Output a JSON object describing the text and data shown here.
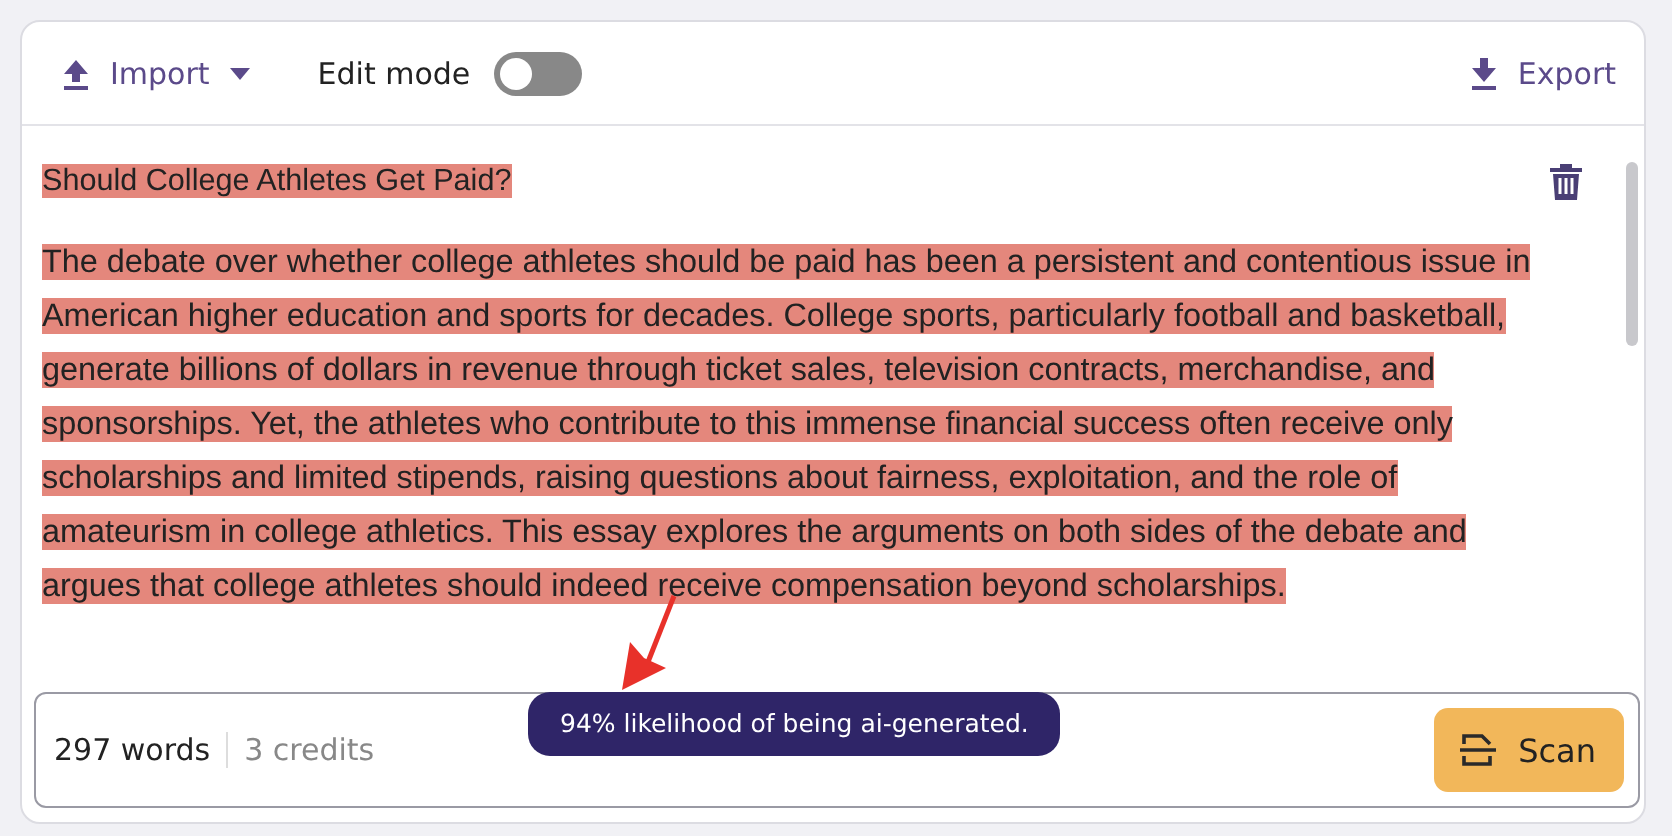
{
  "toolbar": {
    "import_label": "Import",
    "edit_mode": {
      "label": "Edit mode",
      "on": false
    },
    "export_label": "Export"
  },
  "document": {
    "blocks": [
      {
        "kind": "title",
        "text": "Should College Athletes Get Paid?",
        "highlighted": true
      },
      {
        "kind": "paragraph",
        "text": "The debate over whether college athletes should be paid has been a persistent and contentious issue in American higher education and sports for decades.  College sports, particularly football and basketball, generate billions of dollars in revenue through ticket sales, television contracts, merchandise, and sponsorships.  Yet, the athletes who contribute to this immense financial success often receive only scholarships and limited stipends, raising questions about fairness, exploitation, and the role of amateurism in college athletics.  This essay explores the arguments on both sides of the debate and argues that college athletes should indeed receive compensation beyond scholarships.",
        "highlighted": true
      }
    ]
  },
  "footer": {
    "words": "297 words",
    "credits": "3 credits",
    "tooltip": "94% likelihood of being ai-generated.",
    "scan_label": "Scan"
  }
}
